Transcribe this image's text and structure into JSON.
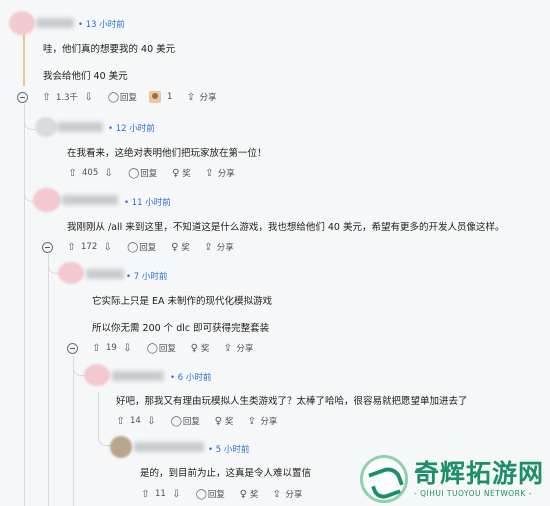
{
  "comments": [
    {
      "time": "13 小时前",
      "lines": [
        "哇，他们真的想要我的 40 美元",
        "我会给他们 40 美元"
      ],
      "votes": "1.3千",
      "reply_label": "回复",
      "award_count": "1",
      "share_label": "分享"
    },
    {
      "time": "12 小时前",
      "lines": [
        "在我看来，这绝对表明他们把玩家放在第一位！"
      ],
      "votes": "405",
      "reply_label": "回复",
      "award_label": "奖",
      "share_label": "分享"
    },
    {
      "time": "11 小时前",
      "lines": [
        "我刚刚从 /all 来到这里，不知道这是什么游戏，我也想给他们 40 美元，希望有更多的开发人员像这样。"
      ],
      "votes": "172",
      "reply_label": "回复",
      "award_label": "奖",
      "share_label": "分享"
    },
    {
      "time": "7 小时前",
      "lines": [
        "它实际上只是 EA 未制作的现代化模拟游戏",
        "所以你无需 200 个 dlc 即可获得完整套装"
      ],
      "votes": "19",
      "reply_label": "回复",
      "award_label": "奖",
      "share_label": "分享"
    },
    {
      "time": "6 小时前",
      "lines": [
        "好吧，那我又有理由玩模拟人生类游戏了？太棒了哈哈，很容易就把愿望单加进去了"
      ],
      "votes": "14",
      "reply_label": "回复",
      "award_label": "奖",
      "share_label": "分享"
    },
    {
      "time": "5 小时前",
      "lines": [
        "是的，到目前为止，这真是令人难以置信"
      ],
      "votes": "11",
      "reply_label": "回复",
      "award_label": "奖",
      "share_label": "分享"
    }
  ],
  "watermark": {
    "title": "奇辉拓游网",
    "subtitle": "- QIHUI TUOYOU NETWORK -"
  },
  "icons": {
    "upvote": "arrow-up-icon",
    "downvote": "arrow-down-icon",
    "reply": "speech-bubble-icon",
    "award": "award-icon",
    "share": "share-arrow-icon",
    "collapse": "collapse-minus-icon"
  },
  "colors": {
    "timestamp": "#2a6fdb",
    "watermark": "#1c8f66",
    "thread_accent": "#e8c78a"
  }
}
